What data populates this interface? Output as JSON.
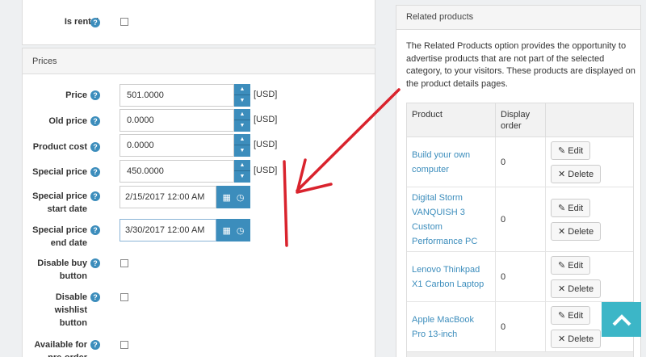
{
  "is_rental": {
    "label": "Is rental"
  },
  "prices": {
    "header": "Prices",
    "price": {
      "label": "Price",
      "value": "501.0000",
      "unit": "[USD]"
    },
    "old_price": {
      "label": "Old price",
      "value": "0.0000",
      "unit": "[USD]"
    },
    "product_cost": {
      "label": "Product cost",
      "value": "0.0000",
      "unit": "[USD]"
    },
    "special_price": {
      "label": "Special price",
      "value": "450.0000",
      "unit": "[USD]"
    },
    "special_start": {
      "label_line1": "Special price",
      "label_line2": "start date",
      "value": "2/15/2017 12:00 AM"
    },
    "special_end": {
      "label_line1": "Special price",
      "label_line2": "end date",
      "value": "3/30/2017 12:00 AM"
    },
    "disable_buy": {
      "label_line1": "Disable buy",
      "label_line2": "button"
    },
    "disable_wishlist": {
      "label_line1": "Disable",
      "label_line2": "wishlist",
      "label_line3": "button"
    },
    "available_preorder": {
      "label_line1": "Available for",
      "label_line2": "pre-order"
    }
  },
  "help_glyph": "?",
  "related": {
    "header": "Related products",
    "description": "The Related Products option provides the opportunity to advertise products that are not part of the selected category, to your visitors. These products are displayed on the product details pages.",
    "col_product": "Product",
    "col_order_line1": "Display",
    "col_order_line2": "order",
    "edit_label": "Edit",
    "delete_label": "Delete",
    "rows": [
      {
        "product": "Build your own computer",
        "order": "0"
      },
      {
        "product": "Digital Storm VANQUISH 3 Custom Performance PC",
        "order": "0"
      },
      {
        "product": "Lenovo Thinkpad X1 Carbon Laptop",
        "order": "0"
      },
      {
        "product": "Apple MacBook Pro 13-inch",
        "order": "0"
      }
    ]
  },
  "colors": {
    "accent": "#3c8dbc",
    "annotation": "#d9232d",
    "scroll_button": "#3cb6c7"
  }
}
